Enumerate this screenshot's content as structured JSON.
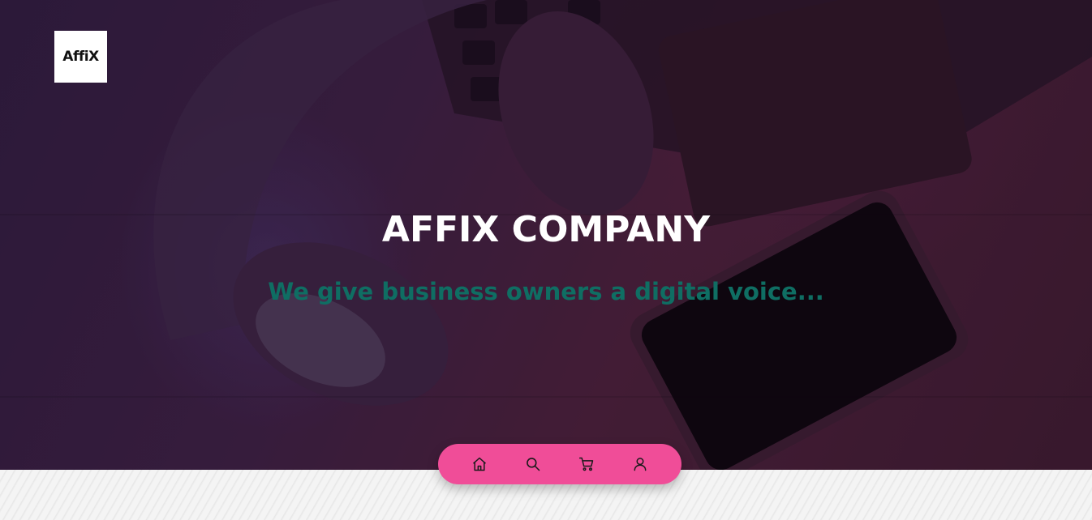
{
  "brand": {
    "logo_text": "AffiX"
  },
  "hero": {
    "title": "AFFIX COMPANY",
    "subtitle": "We give business owners a digital voice..."
  },
  "bottom_nav": {
    "background_color": "#f04d98",
    "items": [
      {
        "icon": "home-icon"
      },
      {
        "icon": "search-icon"
      },
      {
        "icon": "cart-icon"
      },
      {
        "icon": "user-icon"
      }
    ]
  },
  "colors": {
    "title": "#ffffff",
    "subtitle": "#0f6e63"
  }
}
